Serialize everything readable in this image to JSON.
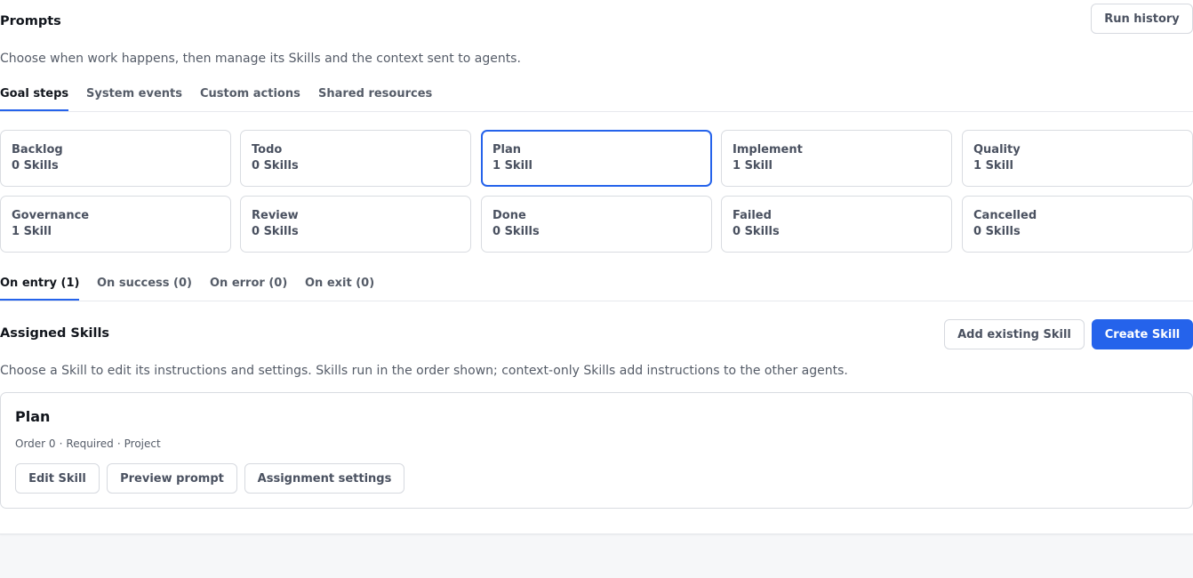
{
  "header": {
    "title": "Prompts",
    "run_history_label": "Run history",
    "subtitle": "Choose when work happens, then manage its Skills and the context sent to agents."
  },
  "main_tabs": [
    {
      "label": "Goal steps",
      "active": true
    },
    {
      "label": "System events",
      "active": false
    },
    {
      "label": "Custom actions",
      "active": false
    },
    {
      "label": "Shared resources",
      "active": false
    }
  ],
  "steps": [
    {
      "name": "Backlog",
      "count": "0 Skills",
      "selected": false
    },
    {
      "name": "Todo",
      "count": "0 Skills",
      "selected": false
    },
    {
      "name": "Plan",
      "count": "1 Skill",
      "selected": true
    },
    {
      "name": "Implement",
      "count": "1 Skill",
      "selected": false
    },
    {
      "name": "Quality",
      "count": "1 Skill",
      "selected": false
    },
    {
      "name": "Governance",
      "count": "1 Skill",
      "selected": false
    },
    {
      "name": "Review",
      "count": "0 Skills",
      "selected": false
    },
    {
      "name": "Done",
      "count": "0 Skills",
      "selected": false
    },
    {
      "name": "Failed",
      "count": "0 Skills",
      "selected": false
    },
    {
      "name": "Cancelled",
      "count": "0 Skills",
      "selected": false
    }
  ],
  "event_tabs": [
    {
      "label": "On entry (1)",
      "active": true
    },
    {
      "label": "On success (0)",
      "active": false
    },
    {
      "label": "On error (0)",
      "active": false
    },
    {
      "label": "On exit (0)",
      "active": false
    }
  ],
  "assigned": {
    "title": "Assigned Skills",
    "add_existing_label": "Add existing Skill",
    "create_label": "Create Skill",
    "description": "Choose a Skill to edit its instructions and settings. Skills run in the order shown; context-only Skills add instructions to the other agents."
  },
  "skill": {
    "name": "Plan",
    "order": "Order 0",
    "required": "Required",
    "scope": "Project",
    "separator": "·",
    "edit_label": "Edit Skill",
    "preview_label": "Preview prompt",
    "settings_label": "Assignment settings"
  },
  "colors": {
    "accent": "#2563eb",
    "text_primary": "#11151c",
    "text_secondary": "#555c68",
    "border": "#d9dce1",
    "page_background": "#f6f7f9"
  }
}
